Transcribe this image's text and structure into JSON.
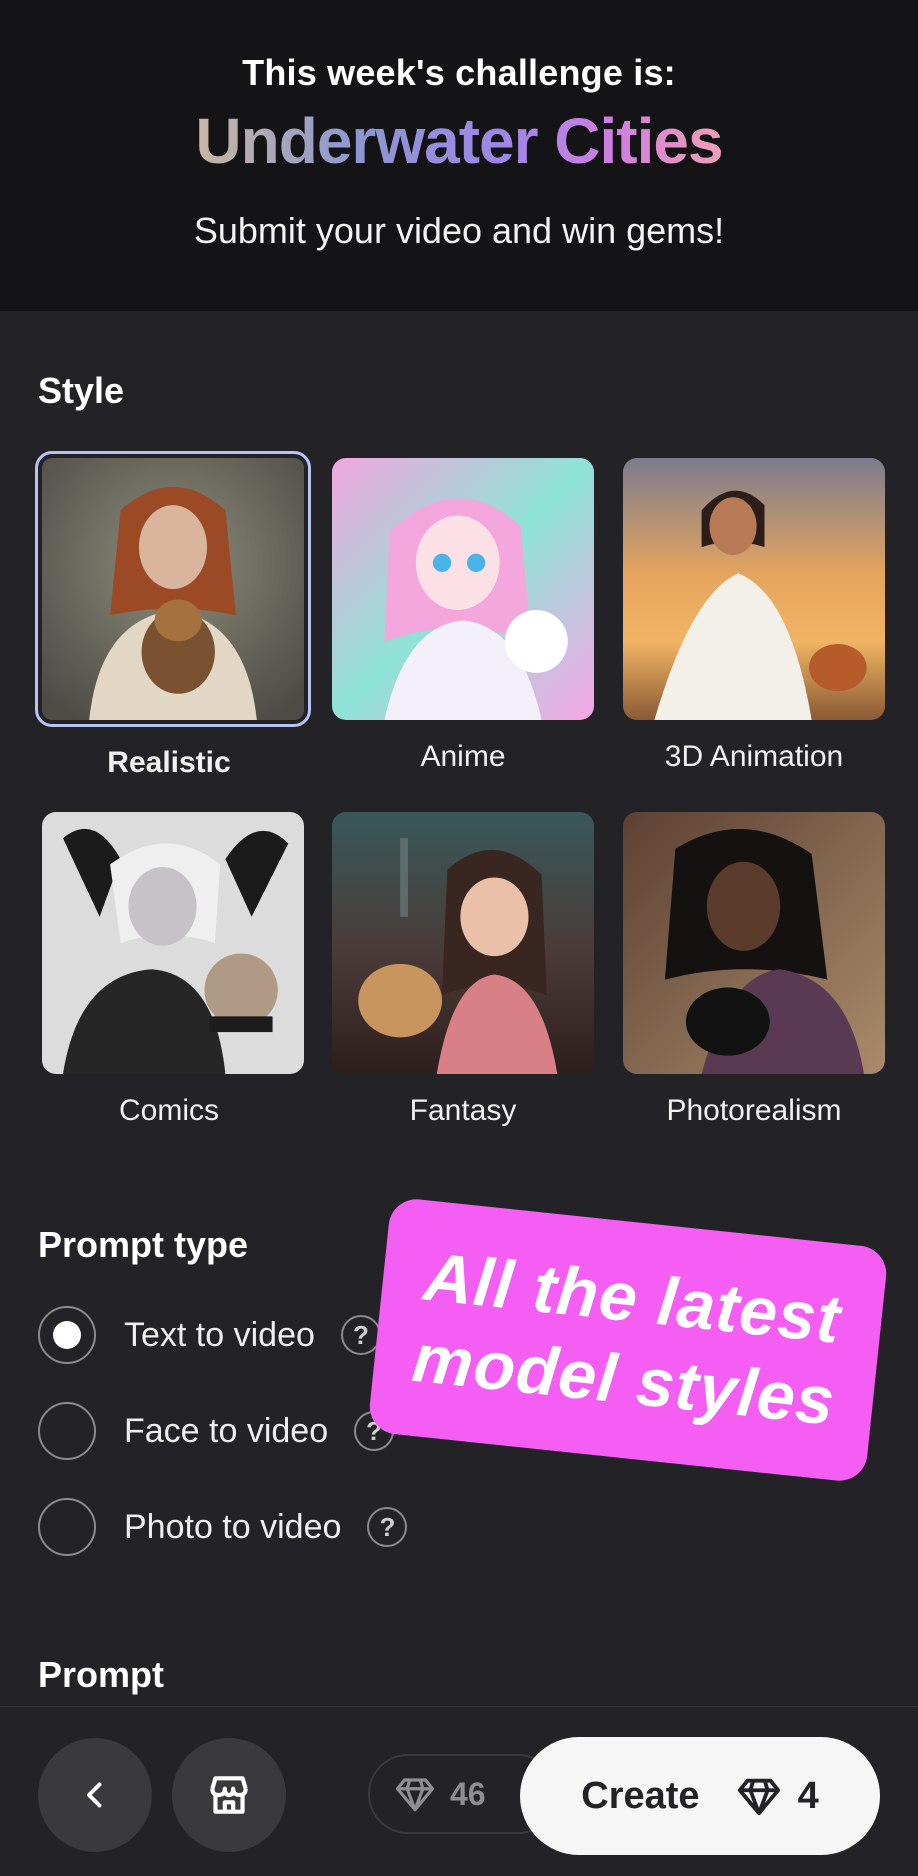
{
  "banner": {
    "kicker": "This week's challenge is:",
    "challenge": "Underwater Cities",
    "subtitle": "Submit your video and win gems!"
  },
  "style_section": {
    "title": "Style",
    "selected": "Realistic",
    "options": [
      {
        "label": "Realistic",
        "icon": "realistic-style-thumbnail"
      },
      {
        "label": "Anime",
        "icon": "anime-style-thumbnail"
      },
      {
        "label": "3D Animation",
        "icon": "3d-animation-style-thumbnail"
      },
      {
        "label": "Comics",
        "icon": "comics-style-thumbnail"
      },
      {
        "label": "Fantasy",
        "icon": "fantasy-style-thumbnail"
      },
      {
        "label": "Photorealism",
        "icon": "photorealism-style-thumbnail"
      }
    ]
  },
  "prompt_type": {
    "title": "Prompt type",
    "selected": "Text to video",
    "options": [
      {
        "label": "Text to video",
        "help": "?"
      },
      {
        "label": "Face to video",
        "help": "?"
      },
      {
        "label": "Photo to video",
        "help": "?"
      }
    ]
  },
  "prompt_section": {
    "title": "Prompt"
  },
  "sticker": {
    "line1": "All the latest",
    "line2": "model styles",
    "color": "#f45ef2"
  },
  "bottom_bar": {
    "back_icon": "chevron-left-icon",
    "store_icon": "storefront-icon",
    "gem_balance": "46",
    "create_label": "Create",
    "create_cost": "4"
  },
  "colors": {
    "background": "#232226",
    "banner_background": "#141316",
    "selected_outline": "#b7c2f5"
  }
}
